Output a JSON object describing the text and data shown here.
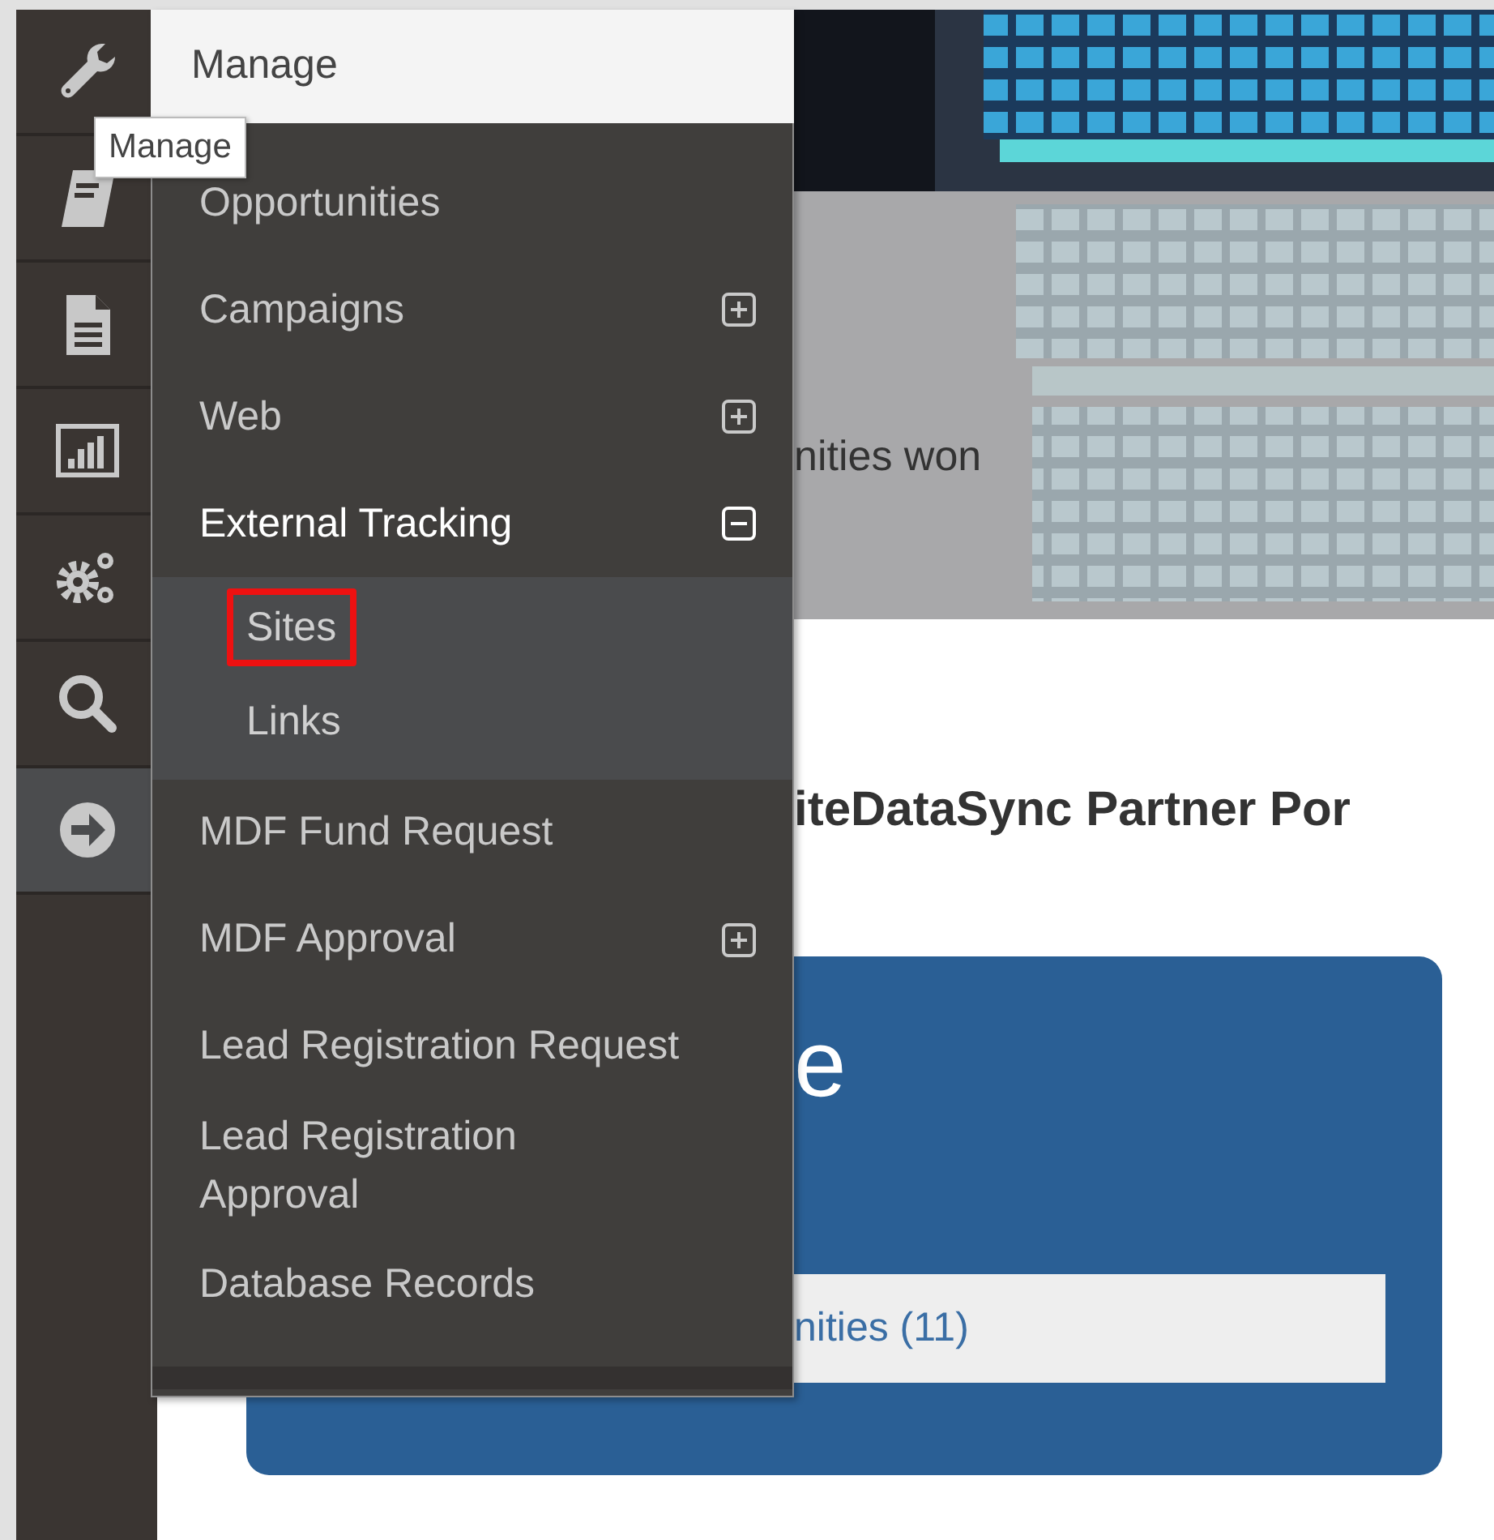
{
  "sidebar": {
    "items": [
      {
        "kind": "wrench",
        "selected": false
      },
      {
        "kind": "book",
        "selected": false
      },
      {
        "kind": "document",
        "selected": false
      },
      {
        "kind": "chart",
        "selected": false
      },
      {
        "kind": "gears",
        "selected": false
      },
      {
        "kind": "search",
        "selected": false
      },
      {
        "kind": "arrow",
        "selected": true
      }
    ]
  },
  "tooltip": "Manage",
  "menu": {
    "title": "Manage",
    "items": [
      {
        "label": "Opportunities"
      },
      {
        "label": "Campaigns",
        "expanded": false
      },
      {
        "label": "Web",
        "expanded": false
      },
      {
        "label": "External Tracking",
        "expanded": true,
        "children": [
          {
            "label": "Sites",
            "highlighted": true
          },
          {
            "label": "Links",
            "highlighted": false
          }
        ]
      },
      {
        "label": "MDF Fund Request"
      },
      {
        "label": "MDF Approval",
        "expanded": false
      },
      {
        "label": "Lead Registration Request"
      },
      {
        "label": "Lead Registration Approval"
      },
      {
        "label": "Database Records"
      }
    ]
  },
  "hero": {
    "text": "nities won"
  },
  "heading": "iteDataSync Partner Por",
  "card": {
    "title": "e",
    "link": "nities (11)"
  }
}
